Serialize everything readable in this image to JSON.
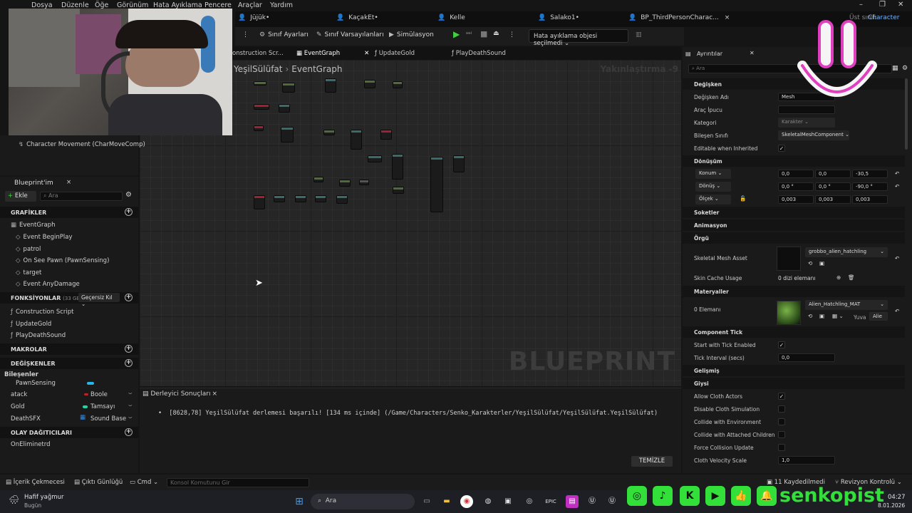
{
  "menu": [
    "Dosya",
    "Düzenle",
    "Öğe",
    "Görünüm",
    "Hata Ayıklama",
    "Pencere",
    "Araçlar",
    "Yardım"
  ],
  "doc_tabs": [
    "Jüjük•",
    "KaçakEt•",
    "Kelle",
    "Salako1•",
    "BP_ThirdPersonCharac..."
  ],
  "parent_class": {
    "label": "Üst sınıf:",
    "value": "Character"
  },
  "toolbar": {
    "class_settings": "Sınıf Ayarları",
    "class_defaults": "Sınıf Varsayılanları",
    "simulation": "Simülasyon",
    "debug_object": "Hata ayıklama objesi seçilmedi"
  },
  "graph_tabs": [
    "onstruction Scr...",
    "EventGraph",
    "UpdateGold",
    "PlayDeathSound"
  ],
  "graph": {
    "crumb_root": "YeşilSülüfat",
    "crumb_leaf": "EventGraph",
    "zoom": "Yakınlaştırma -9",
    "watermark": "BLUEPRINT"
  },
  "components_partial": {
    "item": "Character Movement (CharMoveComp)"
  },
  "my_blueprint": {
    "title": "Blueprint'im",
    "add": "Ekle",
    "search_placeholder": "Ara",
    "graphs_header": "GRAFİKLER",
    "graph_items": [
      "EventGraph",
      "Event BeginPlay",
      "patrol",
      "On See Pawn (PawnSensing)",
      "target",
      "Event AnyDamage"
    ],
    "functions_header": "FONKSİYONLAR",
    "functions_count": "(33 GEÇERSİ",
    "override_label": "Geçersiz Kıl",
    "function_items": [
      "Construction Script",
      "UpdateGold",
      "PlayDeathSound"
    ],
    "macros_header": "MAKROLAR",
    "variables_header": "DEĞİŞKENLER",
    "components_label": "Bileşenler",
    "variables": [
      {
        "name": "PawnSensing",
        "type": "",
        "color": "#27b6e8"
      },
      {
        "name": "atack",
        "type": "Boole",
        "color": "#c0202a"
      },
      {
        "name": "Gold",
        "type": "Tamsayı",
        "color": "#21d4a8"
      },
      {
        "name": "DeathSFX",
        "type": "Sound Base",
        "color": "#2a8ae8"
      }
    ],
    "dispatchers_header": "OLAY DAĞITICILARI",
    "dispatcher_items": [
      "OnEliminetrd"
    ]
  },
  "compiler": {
    "tab": "Derleyici Sonuçları",
    "message": "[8628,78] YeşilSülüfat derlemesi başarılı! [134 ms içinde] (/Game/Characters/Senko_Karakterler/YeşilSülüfat/YeşilSülüfat.YeşilSülüfat)",
    "clear": "TEMİZLE"
  },
  "details": {
    "title": "Ayrıntılar",
    "search_placeholder": "Ara",
    "variable_header": "Değişken",
    "variable_name_label": "Değişken Adı",
    "variable_name": "Mesh",
    "tooltip_label": "Araç İpucu",
    "category_label": "Kategori",
    "category": "Karakter",
    "component_class_label": "Bileşen Sınıfı",
    "component_class": "SkeletalMeshComponent",
    "editable_label": "Editable when Inherited",
    "transform_header": "Dönüşüm",
    "location_label": "Konum",
    "location": [
      "0,0",
      "0,0",
      "-30,5"
    ],
    "rotation_label": "Dönüş",
    "rotation": [
      "0,0 °",
      "0,0 °",
      "-90,0 °"
    ],
    "scale_label": "Ölçek",
    "scale": [
      "0,003",
      "0,003",
      "0,003"
    ],
    "sockets_header": "Soketler",
    "animation_header": "Animasyon",
    "mesh_header": "Örgü",
    "skeletal_mesh_label": "Skeletal Mesh Asset",
    "skeletal_mesh": "grobbo_alien_hatchling",
    "skin_cache_label": "Skin Cache Usage",
    "skin_cache": "0 dizi elemanı",
    "materials_header": "Materyaller",
    "elements_label": "0 Elemanı",
    "material": "Alien_Hatchling_MAT",
    "slot_label": "Yuva",
    "slot_value": "Alie",
    "component_tick_header": "Component Tick",
    "start_tick_label": "Start with Tick Enabled",
    "tick_interval_label": "Tick Interval (secs)",
    "tick_interval": "0,0",
    "advanced_header": "Gelişmiş",
    "cloth_header": "Giysi",
    "allow_cloth_label": "Allow Cloth Actors",
    "disable_cloth_label": "Disable Cloth Simulation",
    "collide_env_label": "Collide with Environment",
    "collide_children_label": "Collide with Attached Children",
    "force_collision_label": "Force Collision Update",
    "cloth_velocity_label": "Cloth Velocity Scale",
    "cloth_velocity": "1,0"
  },
  "statusbar": {
    "content_drawer": "İçerik Çekmecesi",
    "output_log": "Çıktı Günlüğü",
    "cmd": "Cmd",
    "console_placeholder": "Konsol Komutunu Gir",
    "saved": "11 Kaydedilmedi",
    "revision": "Revizyon Kontrolü"
  },
  "taskbar": {
    "weather": "Hafif yağmur",
    "weather_sub": "Bugün",
    "search": "Ara",
    "time": "04:27",
    "date": "8.01.2026"
  },
  "overlay": {
    "brand": "senkopist"
  }
}
